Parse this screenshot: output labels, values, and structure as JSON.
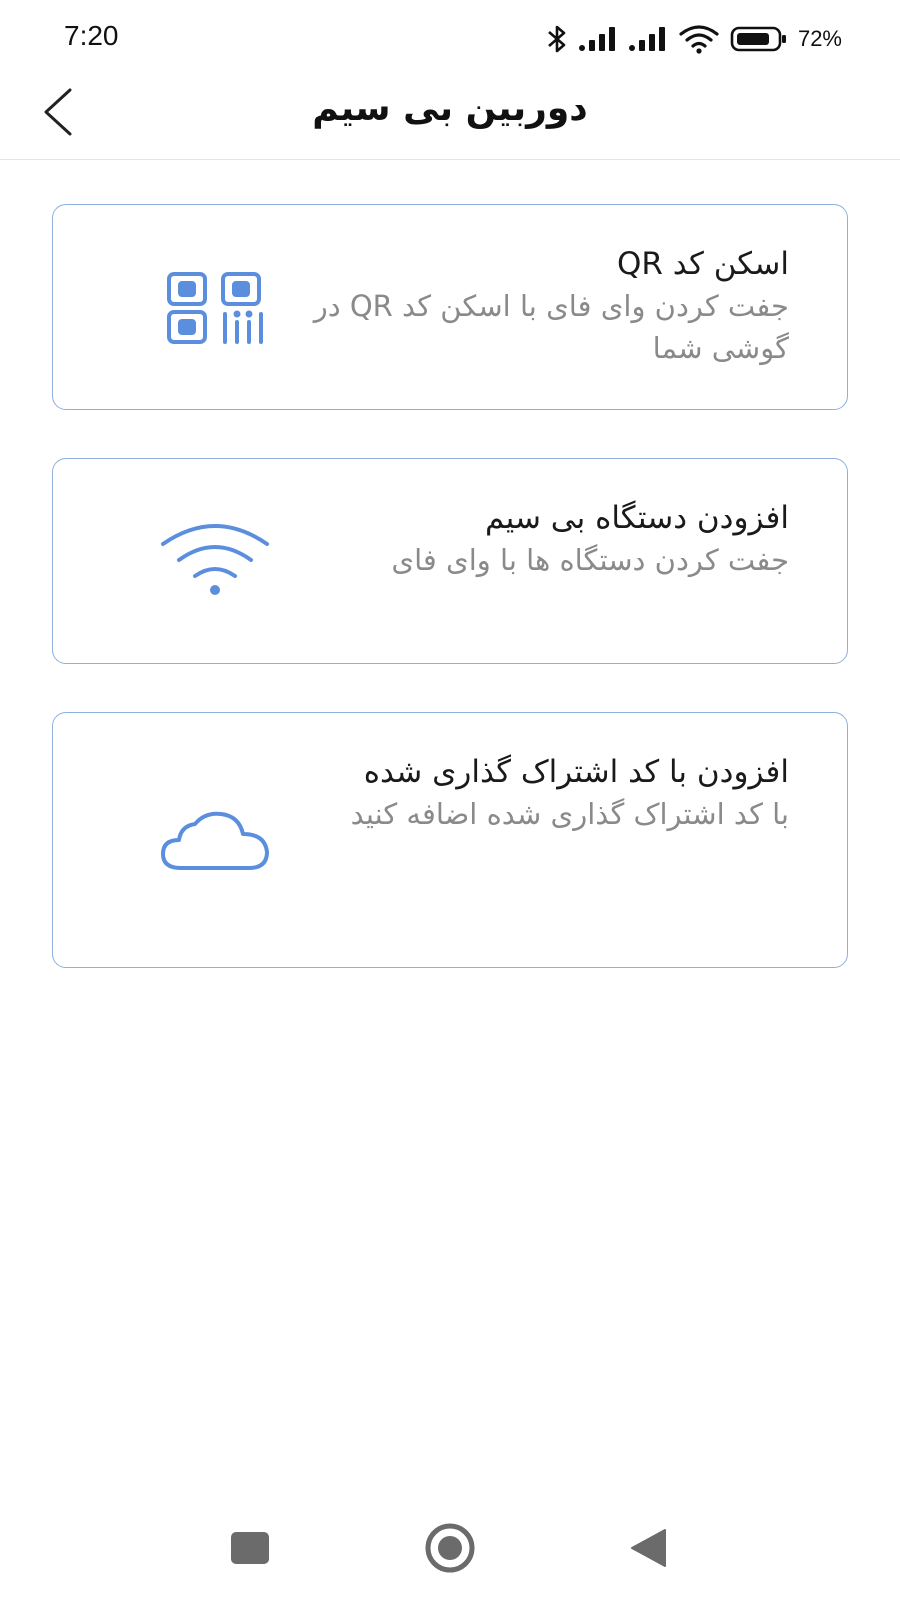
{
  "status_bar": {
    "time": "7:20",
    "battery_percent": "72%",
    "icons": [
      "bluetooth-icon",
      "signal-icon",
      "signal-icon",
      "wifi-icon",
      "battery-icon"
    ]
  },
  "header": {
    "title": "دوربین بی سیم",
    "back_icon": "chevron-left-icon"
  },
  "options": [
    {
      "icon": "qr-code-icon",
      "title": "اسکن کد QR",
      "description": "جفت کردن وای فای با اسکن کد QR در گوشی شما"
    },
    {
      "icon": "wifi-icon",
      "title": "افزودن دستگاه بی سیم",
      "description": "جفت کردن دستگاه ها با وای فای"
    },
    {
      "icon": "cloud-icon",
      "title": "افزودن با کد اشتراک گذاری شده",
      "description": "با کد اشتراک گذاری شده اضافه کنید"
    }
  ],
  "nav_bar": {
    "icons": [
      "recents-square-icon",
      "home-circle-icon",
      "back-triangle-icon"
    ]
  },
  "colors": {
    "accent": "#5b8fde",
    "card_border": "#8fb0dc",
    "secondary_text": "#8a8a8a"
  }
}
